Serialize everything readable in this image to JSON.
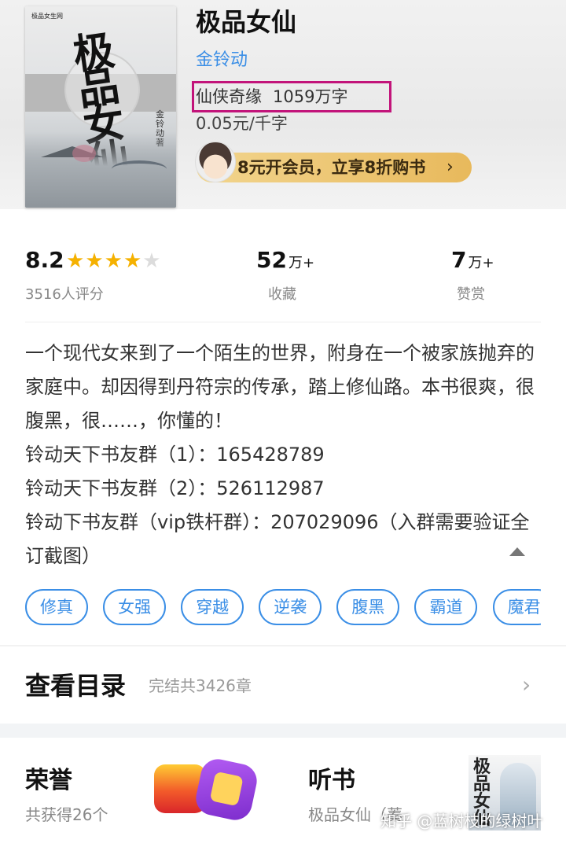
{
  "book": {
    "title": "极品女仙",
    "author": "金铃动",
    "genre": "仙侠奇缘",
    "word_count": "1059万字",
    "price": "0.05元/千字",
    "cover": {
      "title_text": "极品女仙",
      "author_text": "金铃动著",
      "publisher_text": "极品女生网"
    }
  },
  "vip_banner": {
    "label": "8元开会员，立享8折购书",
    "arrow": "›"
  },
  "stats": {
    "rating": "8.2",
    "stars_value": 4,
    "stars_max": 5,
    "rating_count": "3516人评分",
    "favorites_number": "52",
    "favorites_unit": "万+",
    "favorites_label": "收藏",
    "likes_number": "7",
    "likes_unit": "万+",
    "likes_label": "赞赏"
  },
  "description": {
    "text": "一个现代女来到了一个陌生的世界，附身在一个被家族抛弃的家庭中。却因得到丹符宗的传承，踏上修仙路。本书很爽，很腹黑，很……，你懂的！",
    "group1": "铃动天下书友群（1）：165428789",
    "group2": "铃动天下书友群（2）：526112987",
    "group3": "铃动下书友群（vip铁杆群）：207029096（入群需要验证全订截图）"
  },
  "tags": [
    "修真",
    "女强",
    "穿越",
    "逆袭",
    "腹黑",
    "霸道",
    "魔君"
  ],
  "toc": {
    "title": "查看目录",
    "subtitle": "完结共3426章",
    "arrow": "›"
  },
  "honor": {
    "title": "荣誉",
    "subtitle": "共获得26个"
  },
  "listen": {
    "title": "听书",
    "subtitle": "极品女仙（蓁",
    "cover_text": "极品女仙"
  },
  "watermark": "知乎 @蓝树枝的绿树叶",
  "colors": {
    "accent": "#3a8ee6",
    "highlight_box": "#c2147a",
    "star": "#f5b100",
    "vip_gold": "#e8b95c"
  }
}
